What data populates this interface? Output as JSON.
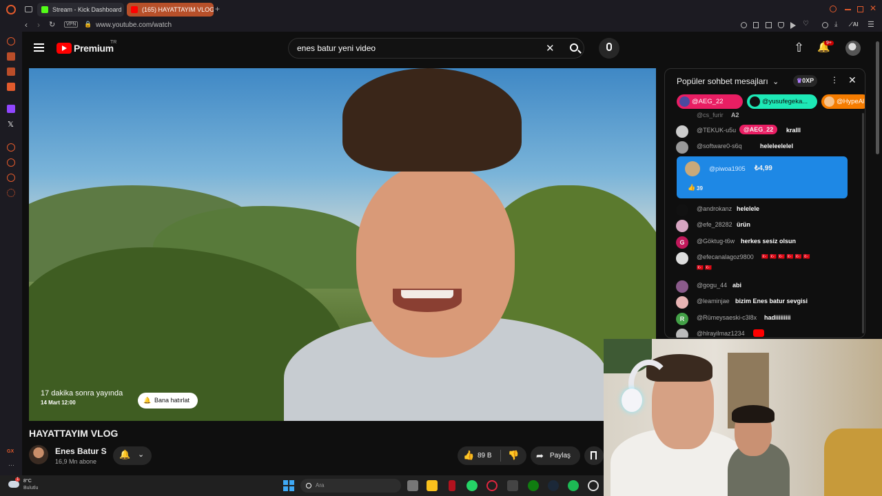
{
  "browser": {
    "tabs": [
      {
        "title": "Stream - Kick Dashboard",
        "favicon": "kick-icon",
        "active": false
      },
      {
        "title": "(165) HAYATTAYIM VLOG",
        "favicon": "youtube-icon",
        "active": true
      }
    ],
    "url": "www.youtube.com/watch",
    "vpn_label": "VPN",
    "ai_label": "AI"
  },
  "youtube": {
    "logo_text": "Premium",
    "logo_region": "TR",
    "search_value": "enes batur yeni video",
    "notif_badge": "9+"
  },
  "video": {
    "premiere_text": "17 dakika sonra yayında",
    "premiere_date": "14 Mart 12:00",
    "remind_label": "Bana hatırlat",
    "title": "HAYATTAYIM VLOG",
    "channel_name": "Enes Batur S",
    "subscribers": "16,9 Mn abone",
    "likes": "89 B",
    "share_label": "Paylaş"
  },
  "chat": {
    "title": "Popüler sohbet mesajları",
    "xp": "0XP",
    "pinned": [
      "@AEG_22",
      "@yusufegeka...",
      "@HypeAl"
    ],
    "cut_message": {
      "author": "@cs_furir",
      "text": "A2"
    },
    "messages": [
      {
        "author": "@TEKUK-u5u",
        "text": "kralll",
        "mention": "@AEG_22"
      },
      {
        "author": "@software0-s6q",
        "text": "heleleelelel"
      },
      {
        "author": "@androkanz",
        "text": "helelele"
      },
      {
        "author": "@efe_28282",
        "text": "ürün"
      },
      {
        "author": "@Göktug-t6w",
        "text": "herkes sesiz olsun",
        "avatar_letter": "G"
      },
      {
        "author": "@efecanalagoz9800",
        "text": "🇹🇷 🇹🇷 🇹🇷 🇹🇷 🇹🇷 🇹🇷",
        "text2": "🇹🇷 🇹🇷"
      },
      {
        "author": "@gogu_44",
        "text": "abi"
      },
      {
        "author": "@leaminjae",
        "text": "bizim Enes batur sevgisi"
      },
      {
        "author": "@Rümeysaeski-c3l8x",
        "text": "hadiiiiiiiii",
        "avatar_letter": "R"
      },
      {
        "author": "@hlrayilmaz1234",
        "text": ""
      }
    ],
    "superchat": {
      "author": "@piwoa1905",
      "amount": "₺4,99",
      "likes": "39"
    }
  },
  "taskbar": {
    "weather_temp": "8°C",
    "weather_desc": "Bulutlu",
    "search_placeholder": "Ara",
    "weather_badge": "1"
  },
  "colors": {
    "accent": "#ff0000",
    "superchat": "#1e88e5",
    "mention_pill": "#e91e63",
    "pill_teal": "#1de9b6",
    "pill_orange": "#f57c00",
    "opera_red": "#e25a2c"
  }
}
